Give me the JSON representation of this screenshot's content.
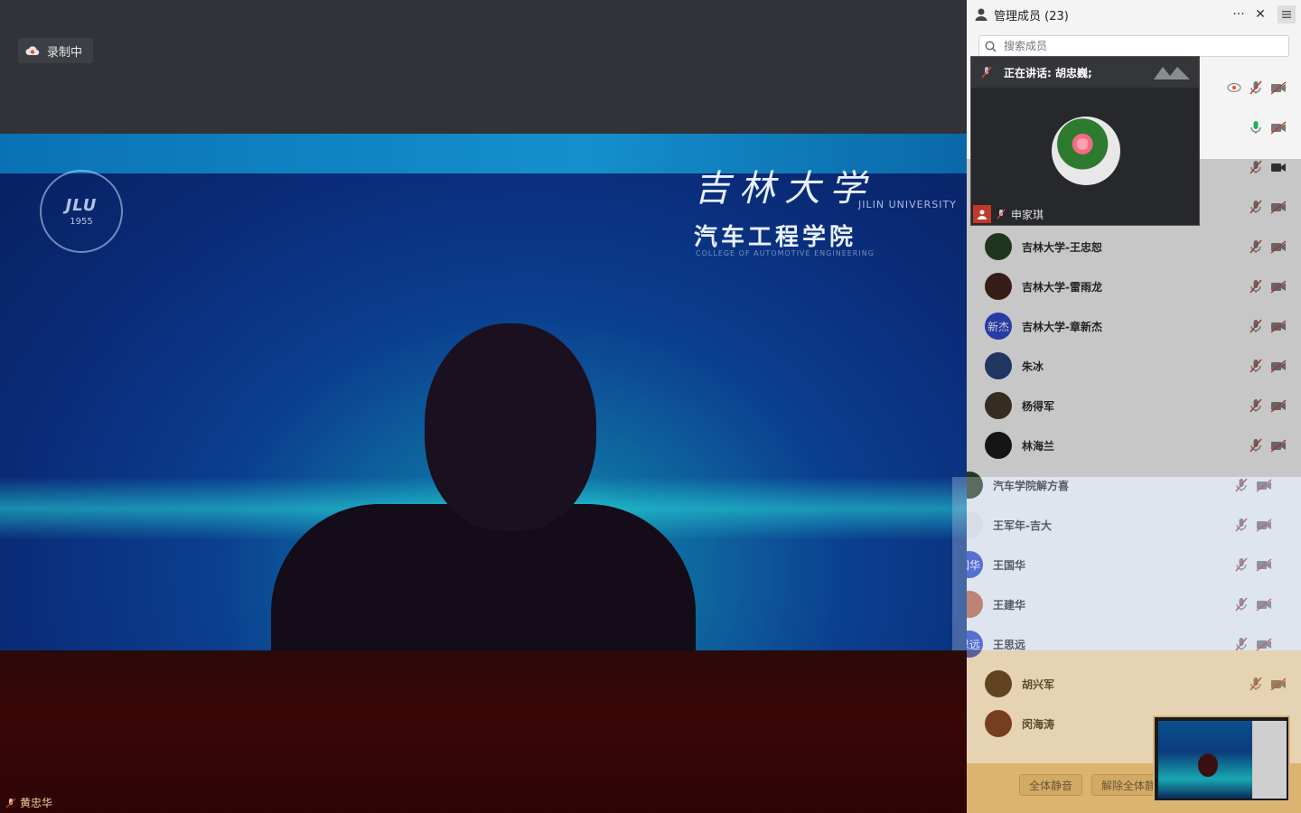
{
  "recording": {
    "label": "录制中"
  },
  "stage": {
    "school_cn": "吉林大学",
    "school_en": "JILIN UNIVERSITY",
    "college_cn": "汽车工程学院",
    "college_en": "COLLEGE OF AUTOMOTIVE ENGINEERING",
    "logo_mark": "JLU",
    "logo_year": "1955",
    "speaker_name": "黄忠华"
  },
  "panel": {
    "title": "管理成员 (23)",
    "more_label": "···",
    "close_label": "✕",
    "search_placeholder": "搜索成员"
  },
  "speaking": {
    "label": "正在讲话: 胡忠巍;",
    "participant_name": "申家琪"
  },
  "members": [
    {
      "name": "",
      "avatar_text": "",
      "avatar_color": "#888888",
      "mic": "muted",
      "cam": "off",
      "extra": "eye"
    },
    {
      "name": "",
      "avatar_text": "",
      "avatar_color": "#888888",
      "mic": "on",
      "cam": "off"
    },
    {
      "name": "",
      "avatar_text": "",
      "avatar_color": "#888888",
      "mic": "muted",
      "cam": "on"
    },
    {
      "name": "",
      "avatar_text": "",
      "avatar_color": "#888888",
      "mic": "muted",
      "cam": "off"
    },
    {
      "name": "吉林大学-王忠恕",
      "avatar_text": "",
      "avatar_color": "#1b3a1b",
      "mic": "muted",
      "cam": "off"
    },
    {
      "name": "吉林大学-雷雨龙",
      "avatar_text": "",
      "avatar_color": "#3a1a12",
      "mic": "muted",
      "cam": "off"
    },
    {
      "name": "吉林大学-章新杰",
      "avatar_text": "新杰",
      "avatar_color": "#2440c8",
      "mic": "muted",
      "cam": "off"
    },
    {
      "name": "朱冰",
      "avatar_text": "",
      "avatar_color": "#1c3a70",
      "mic": "muted",
      "cam": "off"
    },
    {
      "name": "杨得军",
      "avatar_text": "",
      "avatar_color": "#3b2e20",
      "mic": "muted",
      "cam": "off"
    },
    {
      "name": "林海兰",
      "avatar_text": "",
      "avatar_color": "#101010",
      "mic": "muted",
      "cam": "off"
    },
    {
      "name": "汽车学院解方喜",
      "avatar_text": "",
      "avatar_color": "#2a3a1a",
      "mic": "muted",
      "cam": "off"
    },
    {
      "name": "王军年-吉大",
      "avatar_text": "",
      "avatar_color": "#e8e8e8",
      "mic": "muted",
      "cam": "off"
    },
    {
      "name": "王国华",
      "avatar_text": "国华",
      "avatar_color": "#2440c8",
      "mic": "muted",
      "cam": "off"
    },
    {
      "name": "王建华",
      "avatar_text": "",
      "avatar_color": "#c0603a",
      "mic": "muted",
      "cam": "off"
    },
    {
      "name": "王思远",
      "avatar_text": "思远",
      "avatar_color": "#2440c8",
      "mic": "muted",
      "cam": "off"
    },
    {
      "name": "胡兴军",
      "avatar_text": "",
      "avatar_color": "#2a1a10",
      "mic": "muted",
      "cam": "off"
    },
    {
      "name": "闵海涛",
      "avatar_text": "",
      "avatar_color": "#4a1010",
      "mic": "",
      "cam": ""
    }
  ],
  "footer": {
    "mute_all": "全体静音",
    "unmute_all": "解除全体静音"
  },
  "colors": {
    "mic_muted": "#c0392b",
    "mic_on": "#27ae60",
    "accent_gold": "#e6c38a"
  }
}
